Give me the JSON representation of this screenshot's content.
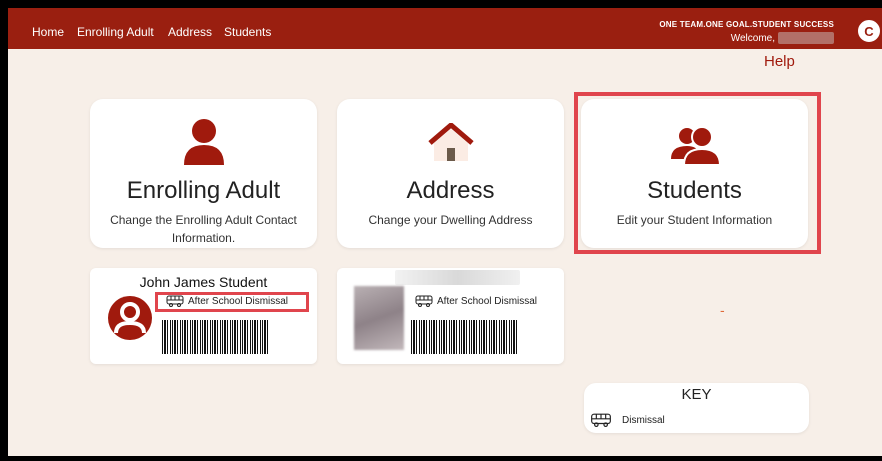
{
  "nav": {
    "items": [
      {
        "label": "Home"
      },
      {
        "label": "Enrolling Adult"
      },
      {
        "label": "Address"
      },
      {
        "label": "Students"
      }
    ],
    "slogan": "ONE TEAM.ONE GOAL.STUDENT SUCCESS",
    "welcome": "Welcome,",
    "logo_letter": "C"
  },
  "help": "Help",
  "cards": [
    {
      "title": "Enrolling Adult",
      "subtitle": "Change the Enrolling Adult Contact Information.",
      "icon": "person-icon"
    },
    {
      "title": "Address",
      "subtitle": "Change your Dwelling Address",
      "icon": "house-icon"
    },
    {
      "title": "Students",
      "subtitle": "Edit your Student Information",
      "icon": "students-icon"
    }
  ],
  "students": [
    {
      "name": "John James Student",
      "dismissal": "After School Dismissal"
    },
    {
      "name": "",
      "dismissal": "After School Dismissal"
    }
  ],
  "empty_slot": "-",
  "key": {
    "title": "KEY",
    "items": [
      {
        "icon": "bus-icon",
        "label": "Dismissal"
      }
    ]
  },
  "colors": {
    "brand": "#9a1f10",
    "accent": "#a01a0d",
    "highlight": "#e0454d",
    "background": "#f7efe8"
  }
}
